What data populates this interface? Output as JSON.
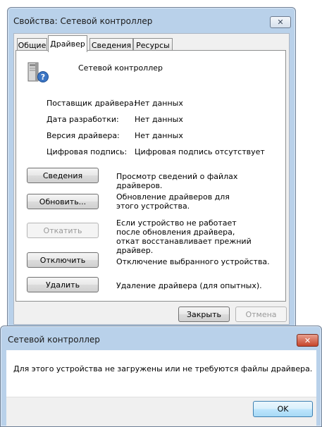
{
  "properties_window": {
    "title": "Свойства: Сетевой контроллер",
    "tabs": [
      {
        "label": "Общие",
        "active": false
      },
      {
        "label": "Драйвер",
        "active": true
      },
      {
        "label": "Сведения",
        "active": false
      },
      {
        "label": "Ресурсы",
        "active": false
      }
    ],
    "device_name": "Сетевой контроллер",
    "info": [
      {
        "label": "Поставщик драйвера:",
        "value": "Нет данных"
      },
      {
        "label": "Дата разработки:",
        "value": "Нет данных"
      },
      {
        "label": "Версия драйвера:",
        "value": "Нет данных"
      },
      {
        "label": "Цифровая подпись:",
        "value": "Цифровая подпись отсутствует"
      }
    ],
    "actions": [
      {
        "label": "Сведения",
        "desc": "Просмотр сведений о файлах драйверов.",
        "enabled": true
      },
      {
        "label": "Обновить...",
        "desc": "Обновление драйверов для этого устройства.",
        "enabled": true
      },
      {
        "label": "Откатить",
        "desc": "Если устройство не работает после обновления драйвера, откат восстанавливает прежний драйвер.",
        "enabled": false
      },
      {
        "label": "Отключить",
        "desc": "Отключение выбранного устройства.",
        "enabled": true
      },
      {
        "label": "Удалить",
        "desc": "Удаление драйвера (для опытных).",
        "enabled": true
      }
    ],
    "close_label": "Закрыть",
    "cancel_label": "Отмена"
  },
  "message_box": {
    "title": "Сетевой контроллер",
    "message": "Для этого устройства не загружены или не требуются файлы драйвера.",
    "ok_label": "OK"
  },
  "colors": {
    "window_frame": "#b9d1ea",
    "close_red": "#c7452b",
    "disabled_text": "#9a9a9a"
  },
  "icons": {
    "device": "network-controller-unknown-icon",
    "close": "close-icon"
  }
}
